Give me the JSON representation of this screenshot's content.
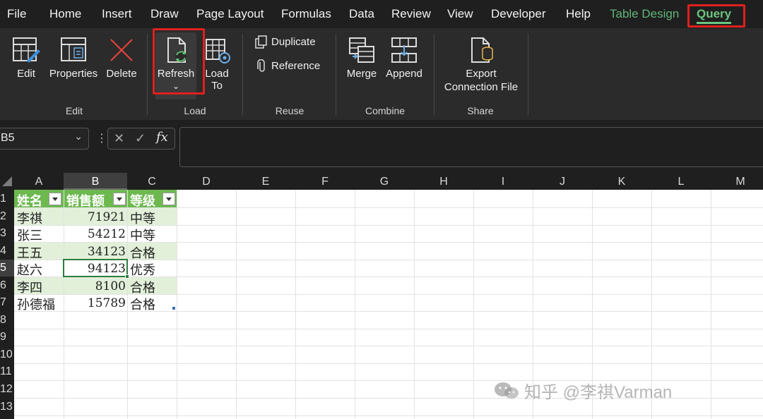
{
  "menu": {
    "tabs": [
      {
        "label": "File"
      },
      {
        "label": "Home"
      },
      {
        "label": "Insert"
      },
      {
        "label": "Draw"
      },
      {
        "label": "Page Layout"
      },
      {
        "label": "Formulas"
      },
      {
        "label": "Data"
      },
      {
        "label": "Review"
      },
      {
        "label": "View"
      },
      {
        "label": "Developer"
      },
      {
        "label": "Help"
      },
      {
        "label": "Table Design"
      },
      {
        "label": "Query"
      }
    ],
    "active_tab": "Query",
    "accent_color": "#6cc57f",
    "highlight_color": "#e0201c"
  },
  "ribbon": {
    "edit": {
      "edit_label": "Edit",
      "properties_label": "Properties",
      "delete_label": "Delete",
      "group_label": "Edit"
    },
    "load": {
      "refresh_label": "Refresh",
      "load_to_label_1": "Load",
      "load_to_label_2": "To",
      "group_label": "Load"
    },
    "reuse": {
      "duplicate_label": "Duplicate",
      "reference_label": "Reference",
      "group_label": "Reuse"
    },
    "combine": {
      "merge_label": "Merge",
      "append_label": "Append",
      "group_label": "Combine"
    },
    "share": {
      "export_label_1": "Export",
      "export_label_2": "Connection File",
      "group_label": "Share"
    }
  },
  "formula_bar": {
    "name_box": "B5",
    "fx_symbol": "fx",
    "cancel_symbol": "✕",
    "enter_symbol": "✓",
    "formula": ""
  },
  "sheet": {
    "columns": [
      "A",
      "B",
      "C",
      "D",
      "E",
      "F",
      "G",
      "H",
      "I",
      "J",
      "K",
      "L",
      "M"
    ],
    "rows": [
      "1",
      "2",
      "3",
      "4",
      "5",
      "6",
      "7",
      "8",
      "9",
      "10",
      "11",
      "12",
      "13"
    ],
    "selected_column": "B",
    "selected_row": "5",
    "table": {
      "headers": [
        "姓名",
        "销售额",
        "等级"
      ],
      "header_color": "#6db950",
      "band_color": "#e2f0d9",
      "rows": [
        {
          "name": "李祺",
          "sales": "71921",
          "grade": "中等"
        },
        {
          "name": "张三",
          "sales": "54212",
          "grade": "中等"
        },
        {
          "name": "王五",
          "sales": "34123",
          "grade": "合格"
        },
        {
          "name": "赵六",
          "sales": "94123",
          "grade": "优秀"
        },
        {
          "name": "李四",
          "sales": "8100",
          "grade": "合格"
        },
        {
          "name": "孙德福",
          "sales": "15789",
          "grade": "合格"
        }
      ]
    }
  },
  "watermark": {
    "text": "知乎 @李祺Varman"
  }
}
